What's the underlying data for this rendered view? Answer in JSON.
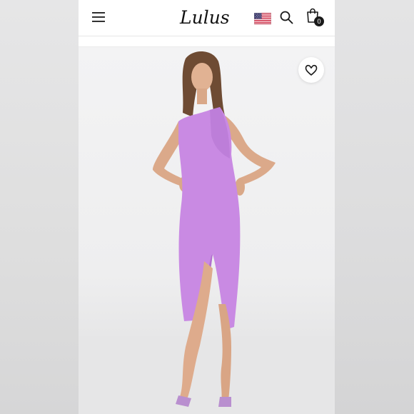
{
  "header": {
    "brand": "Lulus",
    "bag_count": "0"
  },
  "icons": {
    "menu": "hamburger-menu-icon",
    "flag": "us-flag-icon",
    "search": "search-icon",
    "bag": "shopping-bag-icon",
    "wishlist": "heart-icon"
  },
  "colors": {
    "dress": "#c98ae3",
    "background": "#f2f2f3",
    "text": "#1a1a1a"
  }
}
